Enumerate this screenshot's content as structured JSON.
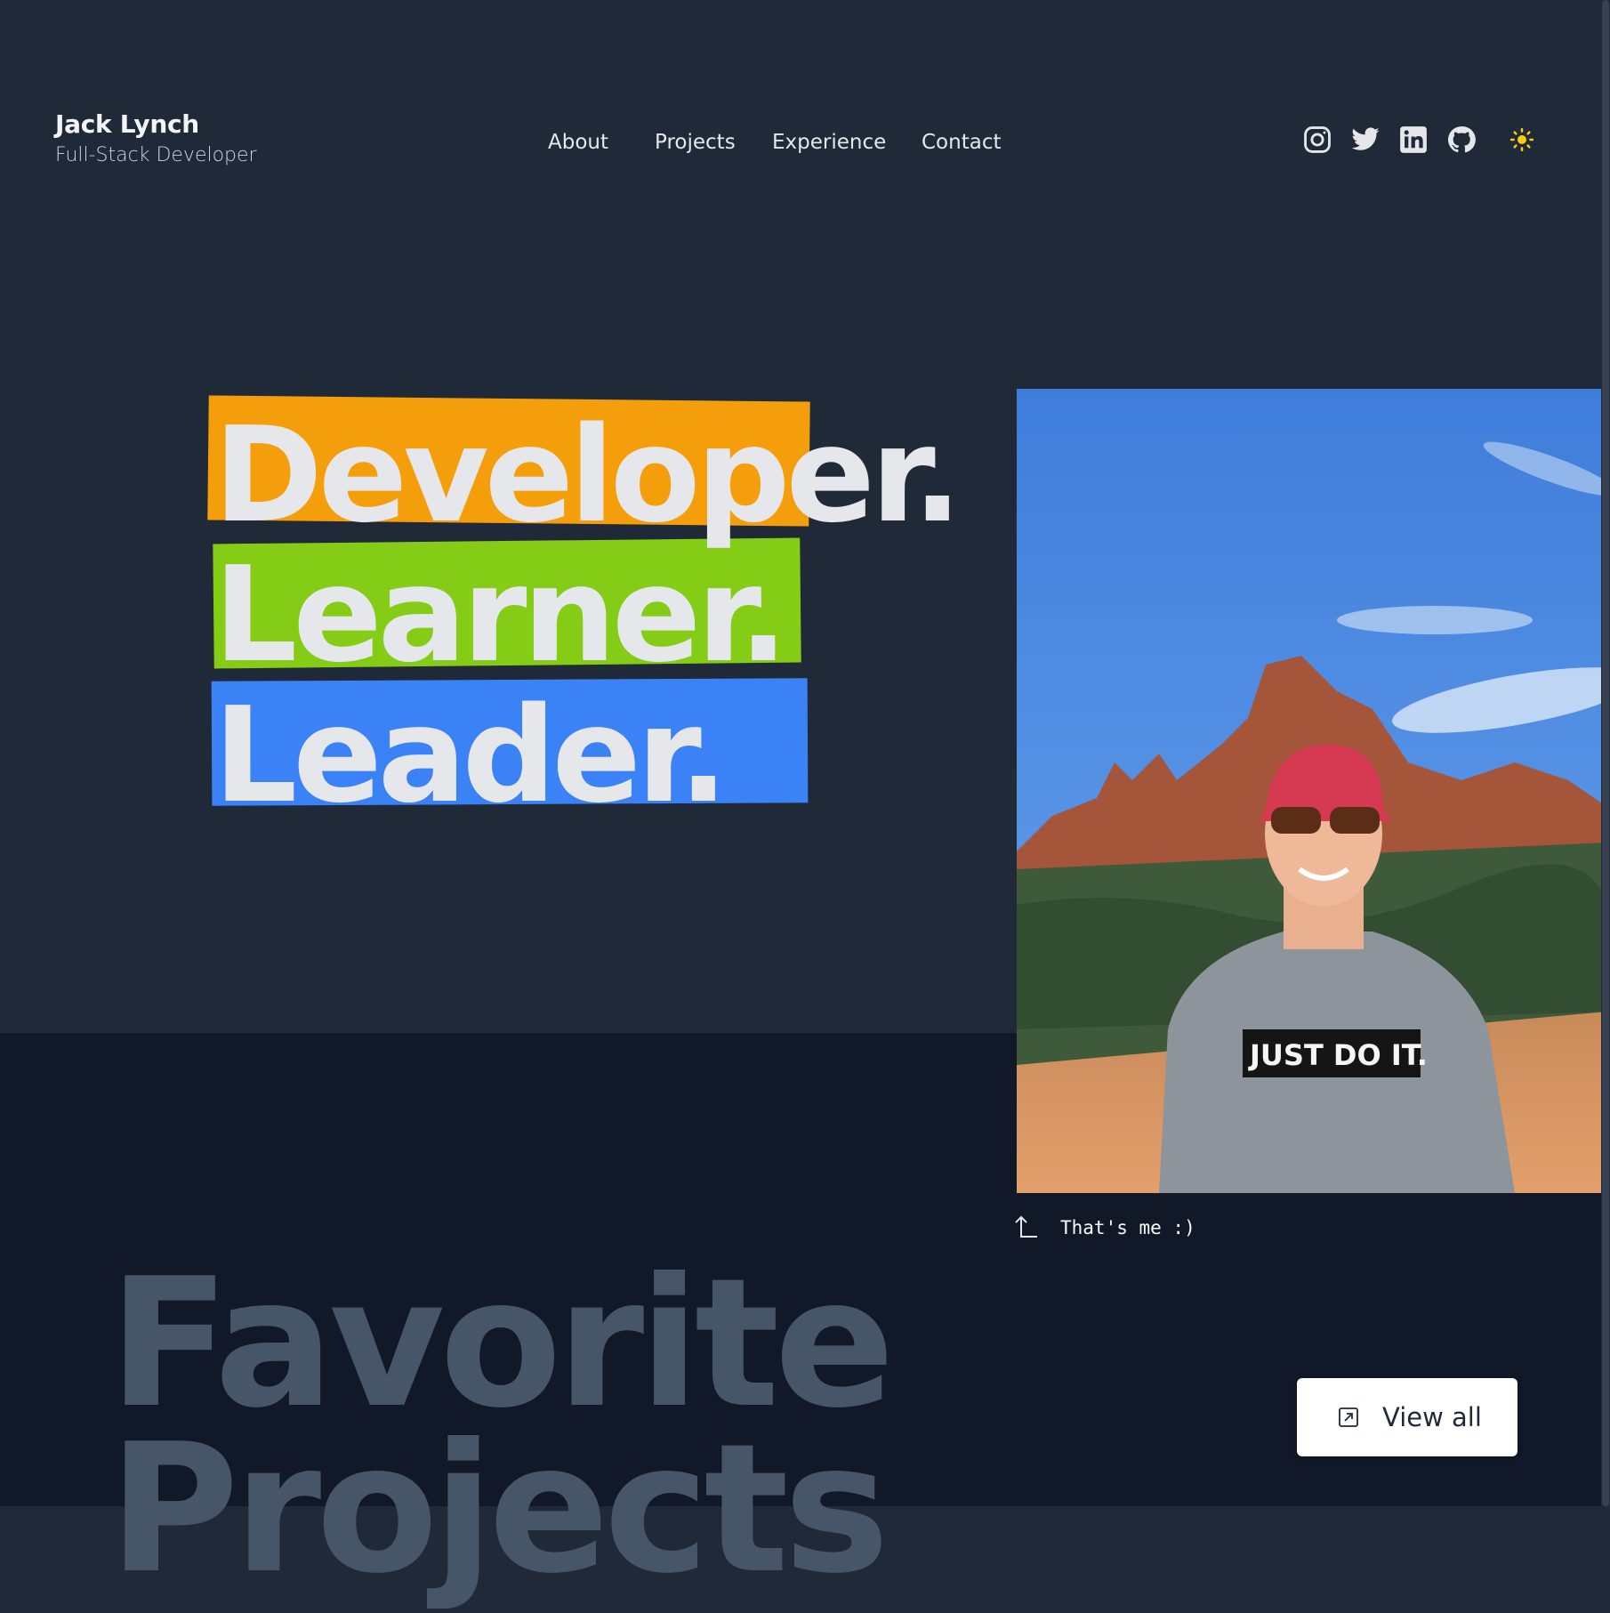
{
  "header": {
    "name": "Jack Lynch",
    "role": "Full-Stack Developer",
    "nav": [
      "About",
      "Projects",
      "Experience",
      "Contact"
    ],
    "socials": [
      "instagram-icon",
      "twitter-icon",
      "linkedin-icon",
      "github-icon"
    ],
    "theme_toggle_icon": "sun-icon"
  },
  "hero": {
    "words": [
      {
        "text": "Developer.",
        "highlight": "#f59e0b"
      },
      {
        "text": "Learner.",
        "highlight": "#84cc16"
      },
      {
        "text": "Leader.",
        "highlight": "#3b82f6"
      }
    ]
  },
  "photo": {
    "shirt_text": "JUST DO IT.",
    "caption": "That's me :)"
  },
  "projects": {
    "title_line1": "Favorite",
    "title_line2": "Projects",
    "view_all": "View all"
  },
  "colors": {
    "bg_top": "#1f2937",
    "bg_bottom": "#111827",
    "title_muted": "#475569",
    "sun": "#facc15"
  }
}
